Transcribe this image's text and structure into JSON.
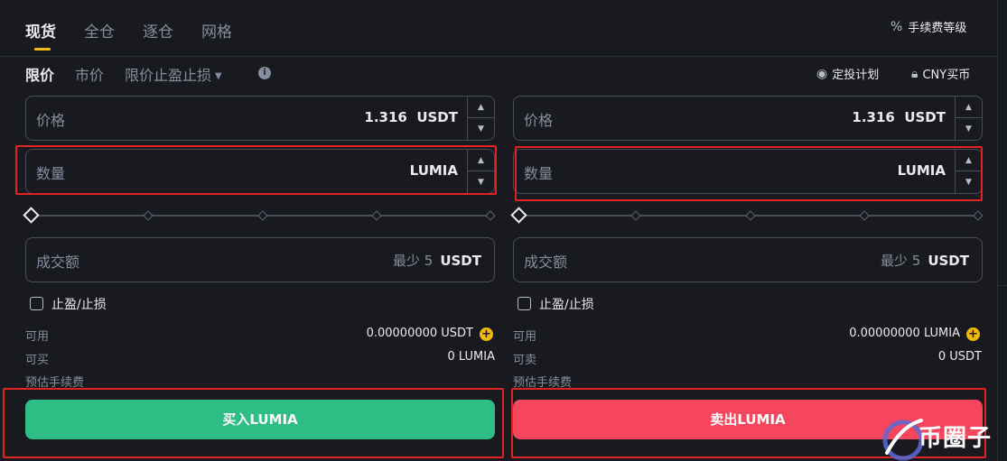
{
  "tabs": [
    {
      "label": "现货"
    },
    {
      "label": "全仓"
    },
    {
      "label": "逐仓"
    },
    {
      "label": "网格"
    }
  ],
  "fee_level": {
    "label": "手续费等级",
    "icon": "percent-icon"
  },
  "order_types": {
    "limit": "限价",
    "market": "市价",
    "stop_limit": "限价止盈止损"
  },
  "links": {
    "dca": "定投计划",
    "cny": "CNY买币"
  },
  "buy": {
    "price_label": "价格",
    "price_value": "1.316",
    "price_unit": "USDT",
    "amount_label": "数量",
    "amount_unit": "LUMIA",
    "total_label": "成交额",
    "total_min": "最少 5",
    "total_unit": "USDT",
    "tpsl_label": "止盈/止损",
    "avail_label": "可用",
    "avail_value": "0.00000000 USDT",
    "max_label": "可买",
    "max_value": "0 LUMIA",
    "fee_label": "预估手续费",
    "button": "买入LUMIA",
    "slider_percent": 0
  },
  "sell": {
    "price_label": "价格",
    "price_value": "1.316",
    "price_unit": "USDT",
    "amount_label": "数量",
    "amount_unit": "LUMIA",
    "total_label": "成交额",
    "total_min": "最少 5",
    "total_unit": "USDT",
    "tpsl_label": "止盈/止损",
    "avail_label": "可用",
    "avail_value": "0.00000000 LUMIA",
    "max_label": "可卖",
    "max_value": "0 USDT",
    "fee_label": "预估手续费",
    "button": "卖出LUMIA",
    "slider_percent": 0
  },
  "watermark": "币圈子",
  "colors": {
    "accent": "#f0b90b",
    "buy": "#2ebd85",
    "sell": "#f6465d",
    "highlight_box": "#e02424",
    "background": "#181a20"
  }
}
